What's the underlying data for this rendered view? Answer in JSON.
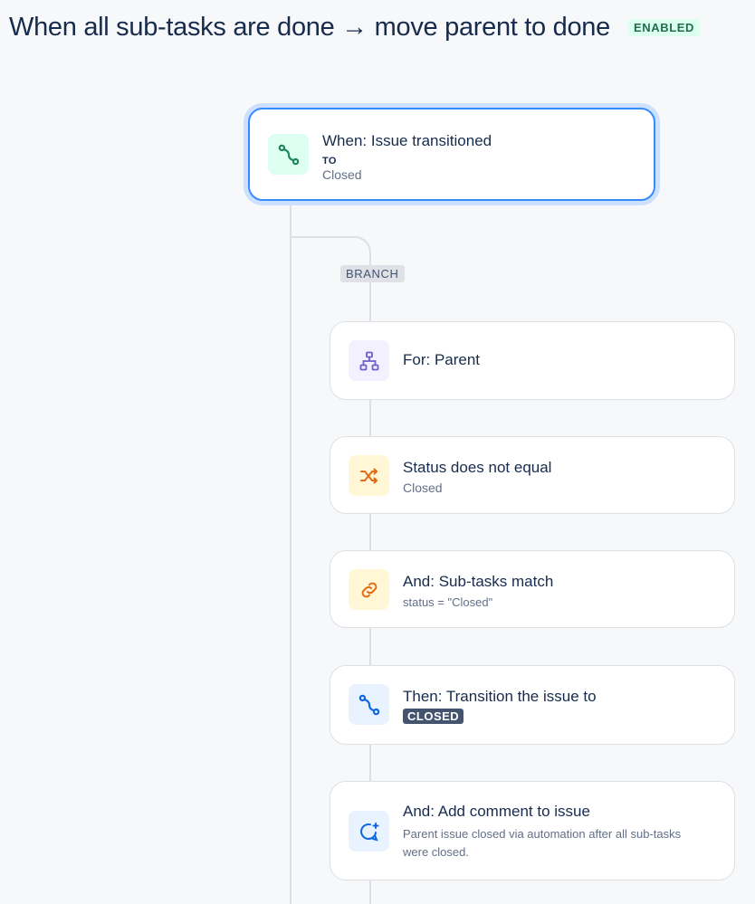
{
  "header": {
    "title": "When all sub-tasks are done → move parent to done",
    "status": "ENABLED"
  },
  "trigger": {
    "title": "When: Issue transitioned",
    "to_label": "TO",
    "to_value": "Closed",
    "icon": "transition-icon"
  },
  "branch": {
    "label": "BRANCH"
  },
  "steps": [
    {
      "title": "For: Parent",
      "subtitle": "",
      "icon": "hierarchy-icon"
    },
    {
      "title": "Status does not equal",
      "subtitle": "Closed",
      "icon": "shuffle-icon"
    },
    {
      "title": "And: Sub-tasks match",
      "subtitle": "status = \"Closed\"",
      "icon": "link-icon"
    },
    {
      "title": "Then: Transition the issue to",
      "lozenge": "CLOSED",
      "icon": "transition-icon"
    },
    {
      "title": "And: Add comment to issue",
      "subtitle": "Parent issue closed via automation after all sub-tasks were closed.",
      "icon": "comment-add-icon"
    }
  ],
  "colors": {
    "accent": "#388bff",
    "enabled_bg": "#dcfff1",
    "enabled_text": "#216e4e"
  }
}
